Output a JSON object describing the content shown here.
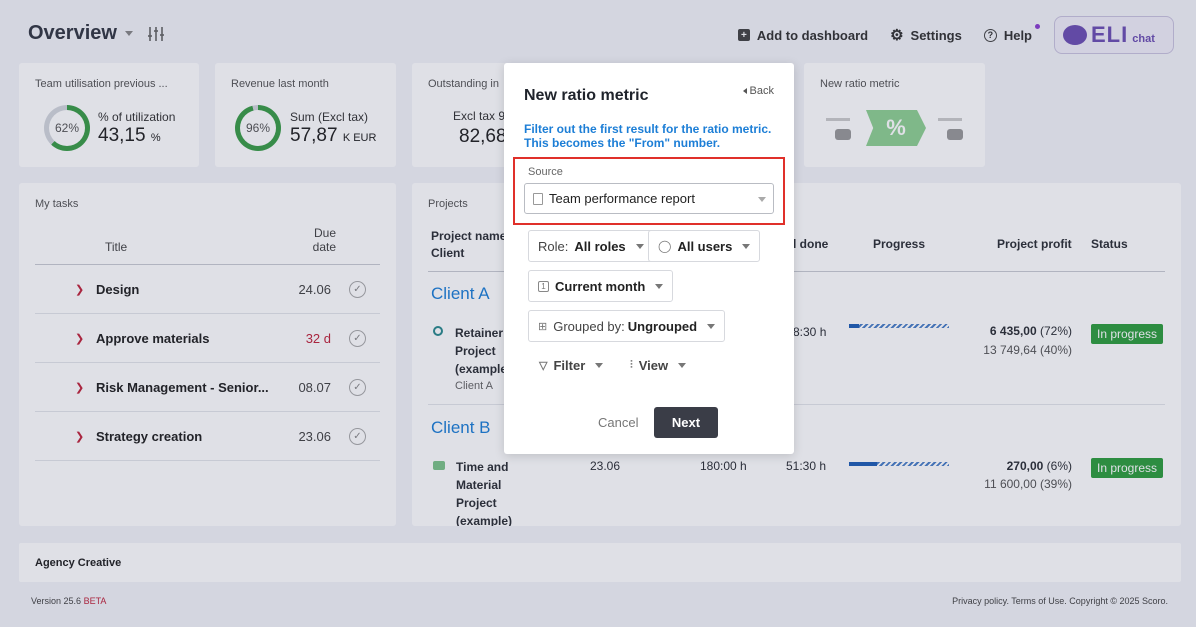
{
  "header": {
    "title": "Overview",
    "add_to_dashboard": "Add to dashboard",
    "settings": "Settings",
    "help": "Help",
    "eli_brand": "ELI",
    "eli_chat": "chat"
  },
  "kpis": {
    "utilisation": {
      "title": "Team utilisation previous ...",
      "percent_label": "62%",
      "percent_value": 62,
      "caption": "% of utilization",
      "value": "43,15",
      "unit": "%"
    },
    "revenue": {
      "title": "Revenue last month",
      "percent_label": "96%",
      "percent_value": 96,
      "caption": "Sum (Excl tax)",
      "value": "57,87",
      "unit": "K EUR"
    },
    "outstanding": {
      "title": "Outstanding in",
      "caption": "Excl tax 9",
      "value": "82,68"
    },
    "new_ratio": {
      "title": "New ratio metric",
      "symbol": "%"
    }
  },
  "tasks": {
    "title": "My tasks",
    "col_title": "Title",
    "col_due": "Due date",
    "rows": [
      {
        "name": "Design",
        "due": "24.06",
        "overdue": false
      },
      {
        "name": "Approve materials",
        "due": "32 d",
        "overdue": true
      },
      {
        "name": "Risk Management - Senior...",
        "due": "08.07",
        "overdue": false
      },
      {
        "name": "Strategy creation",
        "due": "23.06",
        "overdue": false
      }
    ]
  },
  "projects": {
    "title": "Projects",
    "col_name": "Project name",
    "col_client": "Client",
    "col_done": "l done",
    "col_progress": "Progress",
    "col_profit": "Project profit",
    "col_status": "Status",
    "groups": [
      {
        "client": "Client A",
        "project": [
          "Retainer",
          "Project",
          "(example"
        ],
        "project_client": "Client A",
        "done": "8:30 h",
        "progress": 0.1,
        "profit_main": "6 435,00",
        "profit_pct": "(72%)",
        "profit_sub": "13 749,64 (40%)",
        "status": "In progress"
      },
      {
        "client": "Client B",
        "project": [
          "Time and",
          "Material",
          "Project",
          "(example)"
        ],
        "due": "23.06",
        "planned": "180:00 h",
        "done": "51:30 h",
        "progress": 0.28,
        "profit_main": "270,00",
        "profit_pct": "(6%)",
        "profit_sub": "11 600,00 (39%)",
        "status": "In progress"
      }
    ]
  },
  "modal": {
    "title": "New ratio metric",
    "back": "Back",
    "hint": "Filter out the first result for the ratio metric. This becomes the \"From\" number.",
    "source_label": "Source",
    "source_value": "Team performance report",
    "role_label": "Role:",
    "role_value": "All roles",
    "users_value": "All users",
    "period_value": "Current month",
    "period_icon": "1",
    "grouped_label": "Grouped by:",
    "grouped_value": "Ungrouped",
    "filter": "Filter",
    "view": "View",
    "cancel": "Cancel",
    "next": "Next"
  },
  "footer": {
    "company": "Agency Creative",
    "version": "Version 25.6",
    "beta": "BETA",
    "legal": "Privacy policy. Terms of Use. Copyright © 2025 Scoro."
  },
  "colors": {
    "accent": "#1c7ed6",
    "success": "#2e9e3e",
    "danger": "#c0243b",
    "highlight": "#e0302a",
    "brand": "#6d4fb3"
  }
}
